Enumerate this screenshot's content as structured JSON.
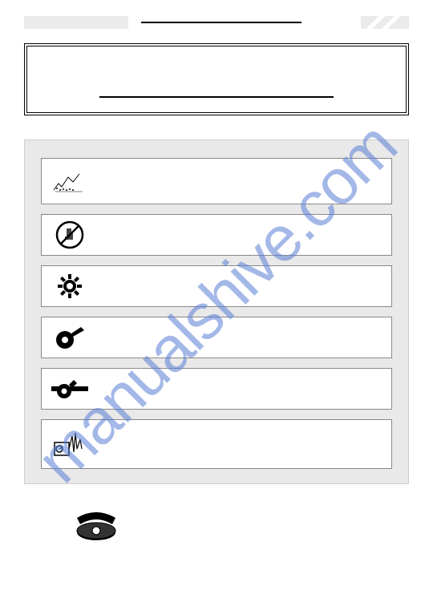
{
  "watermark": "manualshive.com",
  "header": {
    "title_placeholder": ""
  },
  "title_box": {
    "text_placeholder": ""
  },
  "panel": {
    "rows": [
      {
        "icon": "sketch-icon",
        "label": ""
      },
      {
        "icon": "no-touch-icon",
        "label": ""
      },
      {
        "icon": "gear-icon",
        "label": ""
      },
      {
        "icon": "tape-roll-icon",
        "label": ""
      },
      {
        "icon": "wrench-hook-icon",
        "label": ""
      },
      {
        "icon": "oscilloscope-icon",
        "label": ""
      }
    ]
  },
  "footer": {
    "icon": "telephone-icon"
  }
}
